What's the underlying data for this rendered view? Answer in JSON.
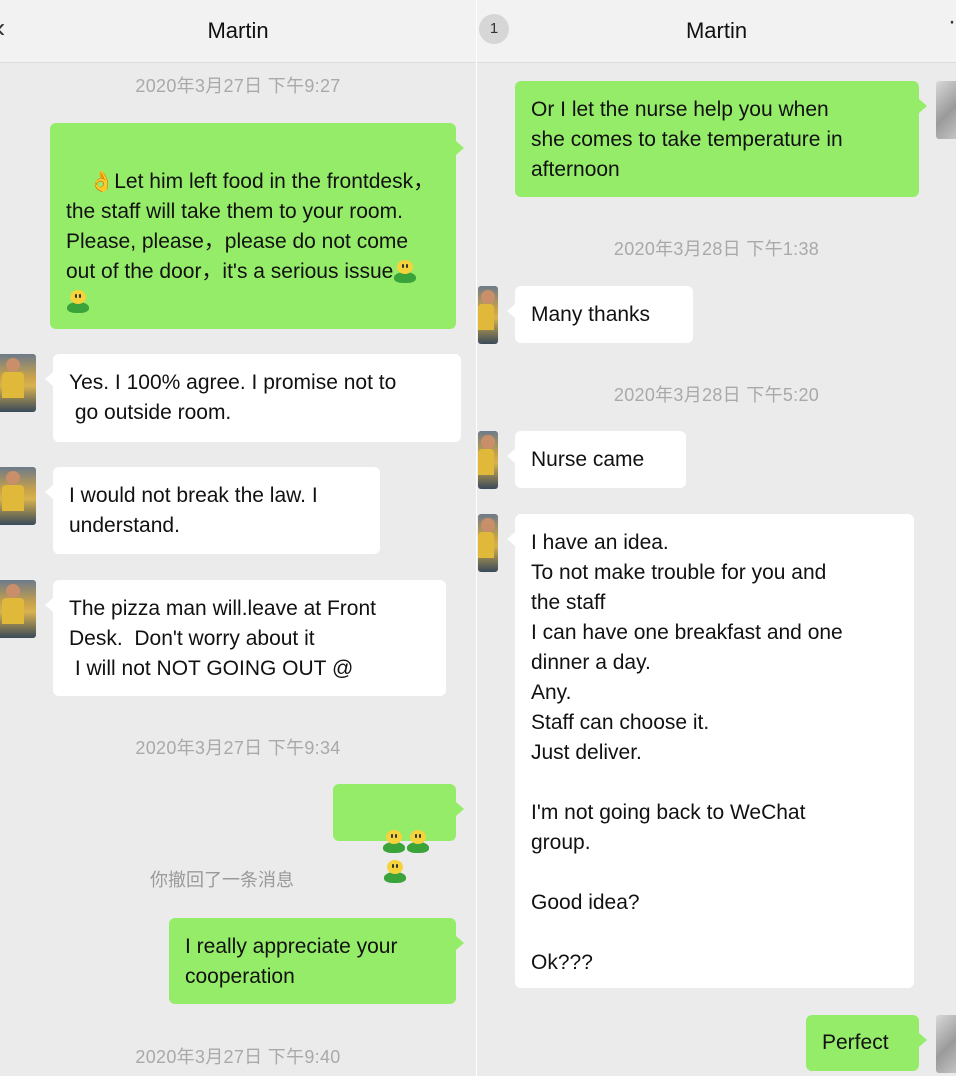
{
  "left": {
    "header": {
      "title": "Martin",
      "back_icon": "chevron-left-icon"
    },
    "timestamps": [
      "2020年3月27日 下午9:27",
      "2020年3月27日 下午9:34",
      "2020年3月27日 下午9:40"
    ],
    "messages": [
      {
        "direction": "sent",
        "lead_icon": "ok-hand-icon",
        "text": "Let him left food in the frontdesk，the staff will take them to your room. Please, please，please do not come out of the door，it's a serious issue",
        "trail_icons": [
          "grinning-leaf-emoji",
          "grinning-leaf-emoji"
        ]
      },
      {
        "direction": "received",
        "text": "Yes. I 100% agree. I promise not to\n go outside room."
      },
      {
        "direction": "received",
        "text": "I would not break the law. I\nunderstand."
      },
      {
        "direction": "received",
        "text": "The pizza man will.leave at Front\nDesk.  Don't worry about it\n I will not NOT GOING OUT @"
      },
      {
        "direction": "sent",
        "emoji_only": [
          "grinning-leaf-emoji",
          "grinning-leaf-emoji",
          "grinning-leaf-emoji"
        ]
      },
      {
        "direction": "sent",
        "text": "I really appreciate your\ncooperation"
      }
    ],
    "system_message": "你撤回了一条消息"
  },
  "right": {
    "header": {
      "title": "Martin",
      "unread_count": "1",
      "more_icon": "more-dots-icon"
    },
    "timestamps": [
      "2020年3月28日 下午1:38",
      "2020年3月28日 下午5:20"
    ],
    "messages": [
      {
        "direction": "sent",
        "text": "Or I let the nurse help you when\nshe comes to take temperature in\nafternoon"
      },
      {
        "direction": "received",
        "text": "Many thanks"
      },
      {
        "direction": "received",
        "text": "Nurse came"
      },
      {
        "direction": "received",
        "text": "I have an idea.\nTo not make trouble for you and\nthe staff\nI can have one breakfast and one\ndinner a day.\nAny.\nStaff can choose it.\nJust deliver.\n\nI'm not going back to WeChat\ngroup.\n\nGood idea?\n\nOk???"
      },
      {
        "direction": "sent",
        "text": "Perfect"
      }
    ]
  },
  "colors": {
    "chat_background": "#ebebeb",
    "sent_bubble": "#95ec69",
    "received_bubble": "#ffffff",
    "timestamp_text": "#a9a9a9"
  }
}
